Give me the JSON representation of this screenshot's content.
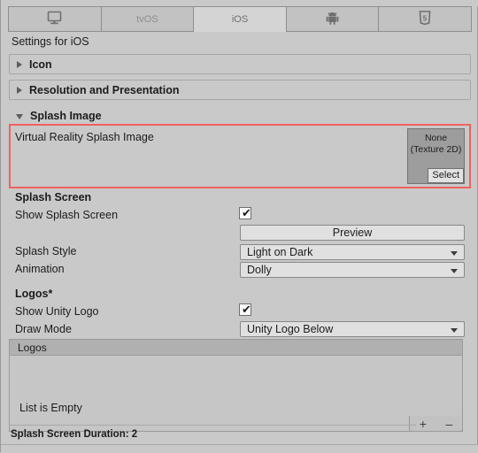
{
  "window": {
    "title": "Settings for iOS"
  },
  "tabs": [
    {
      "label": "",
      "icon": "desktop-monitor-icon",
      "selected": false,
      "name": "tab-standalone"
    },
    {
      "label": "tvOS",
      "icon": "",
      "selected": false,
      "name": "tab-tvos"
    },
    {
      "label": "iOS",
      "icon": "",
      "selected": true,
      "name": "tab-ios"
    },
    {
      "label": "",
      "icon": "android-robot-icon",
      "selected": false,
      "name": "tab-android"
    },
    {
      "label": "",
      "icon": "html5-icon",
      "selected": false,
      "name": "tab-webgl"
    }
  ],
  "foldouts": [
    {
      "label": "Icon",
      "expanded": false
    },
    {
      "label": "Resolution and Presentation",
      "expanded": false
    },
    {
      "label": "Splash Image",
      "expanded": true
    }
  ],
  "splash_image": {
    "vr_splash_label": "Virtual Reality Splash Image",
    "object_field": {
      "value": "None",
      "type": "(Texture 2D)",
      "select_label": "Select"
    }
  },
  "splash_screen": {
    "heading": "Splash Screen",
    "show_splash_screen_label": "Show Splash Screen",
    "show_splash_screen_checked": "✔",
    "preview_label": "Preview",
    "splash_style_label": "Splash Style",
    "splash_style_value": "Light on Dark",
    "animation_label": "Animation",
    "animation_value": "Dolly"
  },
  "logos": {
    "heading": "Logos*",
    "show_unity_logo_label": "Show Unity Logo",
    "show_unity_logo_checked": "✔",
    "draw_mode_label": "Draw Mode",
    "draw_mode_value": "Unity Logo Below",
    "list_header": "Logos",
    "list_empty_text": "List is Empty",
    "add_label": "+",
    "remove_label": "–"
  },
  "footer": {
    "duration_text": "Splash Screen Duration: 2"
  },
  "colors": {
    "panel_bg": "#c9c9c9",
    "highlight_red": "#f16060",
    "field_bg": "#e0e0e0",
    "list_header_bg": "#b0b0b0"
  }
}
